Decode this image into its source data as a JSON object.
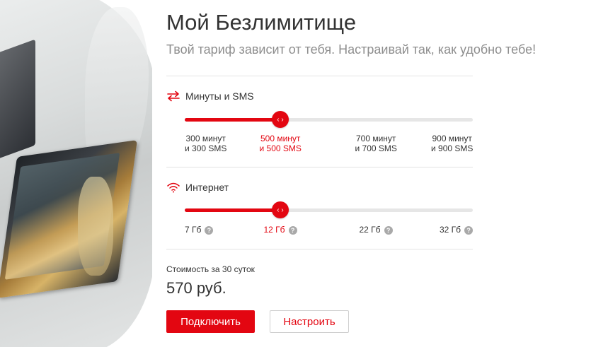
{
  "title": "Мой Безлимитище",
  "subtitle": "Твой тариф зависит от тебя. Настраивай так, как удобно тебе!",
  "colors": {
    "accent": "#e30611",
    "track": "#e6e6e6",
    "muted": "#8e8e8e"
  },
  "minutes": {
    "label": "Минуты и SMS",
    "icon": "arrows-exchange-icon",
    "selected_index": 1,
    "options": [
      {
        "line1": "300 минут",
        "line2": "и 300 SMS"
      },
      {
        "line1": "500 минут",
        "line2": "и 500 SMS"
      },
      {
        "line1": "700 минут",
        "line2": "и 700 SMS"
      },
      {
        "line1": "900 минут",
        "line2": "и 900 SMS"
      }
    ]
  },
  "internet": {
    "label": "Интернет",
    "icon": "wifi-icon",
    "selected_index": 1,
    "options": [
      {
        "label": "7 Гб"
      },
      {
        "label": "12 Гб"
      },
      {
        "label": "22 Гб"
      },
      {
        "label": "32 Гб"
      }
    ]
  },
  "price": {
    "label": "Стоимость за 30 суток",
    "value": "570 руб."
  },
  "buttons": {
    "connect": "Подключить",
    "configure": "Настроить"
  }
}
